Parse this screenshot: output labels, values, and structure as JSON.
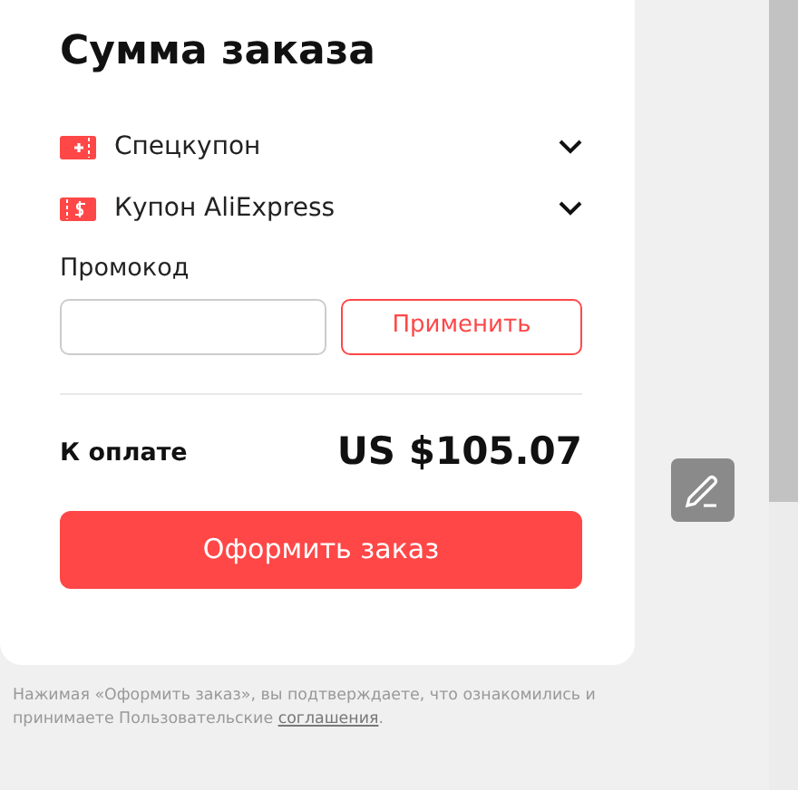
{
  "title": "Сумма заказа",
  "coupons": [
    {
      "kind": "special",
      "label": "Спецкупон",
      "expanded": false
    },
    {
      "kind": "dollar",
      "label": "Купон AliExpress",
      "expanded": false
    }
  ],
  "promo": {
    "label": "Промокод",
    "button": "Применить"
  },
  "total": {
    "label": "К оплате",
    "amount": "US $105.07"
  },
  "checkout_button": "Оформить заказ",
  "legal": {
    "text": "Нажимая «Оформить заказ», вы подтверждаете, что ознакомились и принимаете Пользовательские",
    "link": "соглашения",
    "after": "."
  }
}
